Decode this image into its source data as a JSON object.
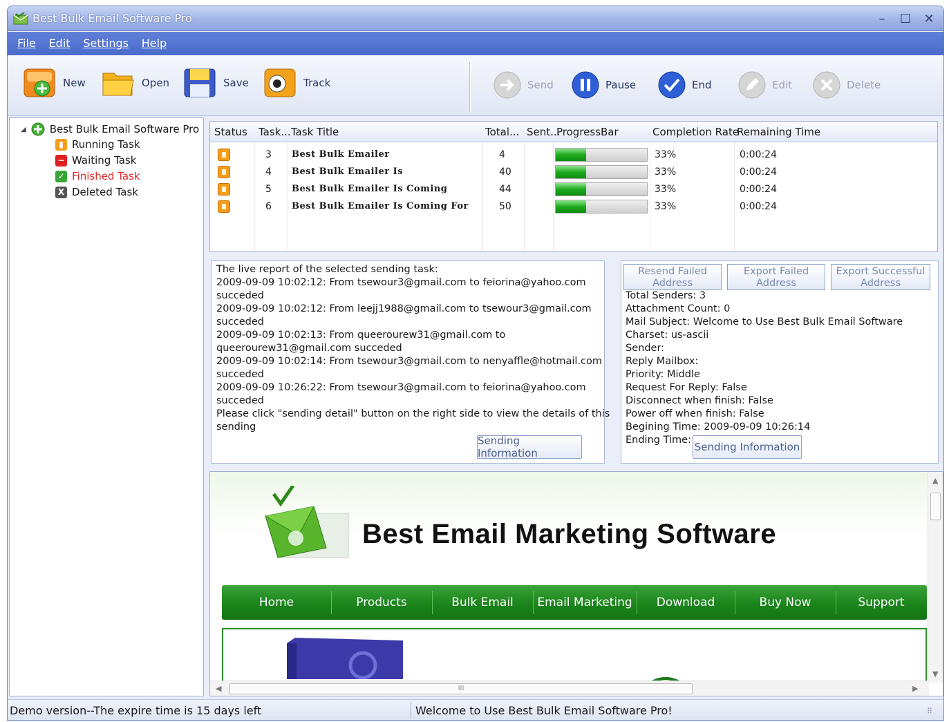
{
  "window": {
    "title": "Best Bulk Email Software Pro"
  },
  "menu": {
    "items": [
      "File",
      "Edit",
      "Settings",
      "Help"
    ]
  },
  "toolbar": {
    "left": [
      {
        "label": "New",
        "icon": "new-icon"
      },
      {
        "label": "Open",
        "icon": "open-folder-icon"
      },
      {
        "label": "Save",
        "icon": "save-disk-icon"
      },
      {
        "label": "Track",
        "icon": "track-icon"
      }
    ],
    "right": [
      {
        "label": "Send",
        "icon": "send-arrow-icon",
        "enabled": false
      },
      {
        "label": "Pause",
        "icon": "pause-icon",
        "enabled": true
      },
      {
        "label": "End",
        "icon": "check-icon",
        "enabled": true
      },
      {
        "label": "Edit",
        "icon": "edit-pencil-icon",
        "enabled": false
      },
      {
        "label": "Delete",
        "icon": "delete-x-icon",
        "enabled": false
      }
    ]
  },
  "tree": {
    "root": "Best Bulk Email Software Pro",
    "items": [
      {
        "label": "Running Task",
        "color": "#f49e1a"
      },
      {
        "label": "Waiting Task",
        "color": "#e02020"
      },
      {
        "label": "Finished Task",
        "color": "#3aa63a",
        "selected": true
      },
      {
        "label": "Deleted Task",
        "color": "#555555"
      }
    ]
  },
  "task_table": {
    "headers": [
      "Status",
      "Task...",
      "Task Title",
      "Total...",
      "Sent...",
      "ProgressBar",
      "Completion Rate",
      "Remaining Time"
    ],
    "rows": [
      {
        "task": "3",
        "title": "Best Bulk Emailer",
        "total": "4",
        "sent": "",
        "progress": 0.33,
        "rate": "33%",
        "remaining": "0:00:24"
      },
      {
        "task": "4",
        "title": "Best Bulk Emailer Is",
        "total": "40",
        "sent": "",
        "progress": 0.33,
        "rate": "33%",
        "remaining": "0:00:24"
      },
      {
        "task": "5",
        "title": "Best Bulk Emailer Is Coming",
        "total": "44",
        "sent": "",
        "progress": 0.33,
        "rate": "33%",
        "remaining": "0:00:24"
      },
      {
        "task": "6",
        "title": "Best Bulk Emailer Is Coming For",
        "total": "50",
        "sent": "",
        "progress": 0.33,
        "rate": "33%",
        "remaining": "0:00:24"
      }
    ]
  },
  "report": {
    "lines": [
      "The live report of the selected sending task:",
      "2009-09-09 10:02:12: From tsewour3@gmail.com to feiorina@yahoo.com",
      "succeded",
      "2009-09-09 10:02:12: From leejj1988@gmail.com to tsewour3@gmail.com",
      "succeded",
      "2009-09-09 10:02:13: From queerourew31@gmail.com to",
      "queerourew31@gmail.com succeded",
      "2009-09-09 10:02:14: From tsewour3@gmail.com to nenyaffle@hotmail.com",
      "succeded",
      "2009-09-09 10:26:22: From tsewour3@gmail.com to feiorina@yahoo.com",
      "succeded",
      "Please click \"sending detail\" button on the right side to view the details of this",
      "sending"
    ],
    "button": "Sending Information"
  },
  "details": {
    "buttons": [
      "Resend Failed Address",
      "Export Failed Address",
      "Export Successful Address"
    ],
    "lines": [
      "Total Senders:  3",
      "Attachment Count:  0",
      "Mail Subject:  Welcome to Use Best Bulk Email Software",
      "Charset:  us-ascii",
      "Sender:",
      "Reply Mailbox:",
      "Priority:  Middle",
      "Request For Reply:  False",
      "Disconnect when finish:  False",
      "Power off when finish:  False",
      "Begining Time:  2009-09-09 10:26:14",
      "Ending Time:"
    ],
    "button": "Sending Information"
  },
  "web": {
    "title": "Best Email Marketing Software",
    "nav": [
      "Home",
      "Products",
      "Bulk Email",
      "Email Marketing",
      "Download",
      "Buy Now",
      "Support"
    ],
    "hscroll_label": "III"
  },
  "statusbar": {
    "left": "Demo version--The expire time is 15 days left",
    "right": "Welcome to Use Best Bulk Email Software Pro!"
  }
}
